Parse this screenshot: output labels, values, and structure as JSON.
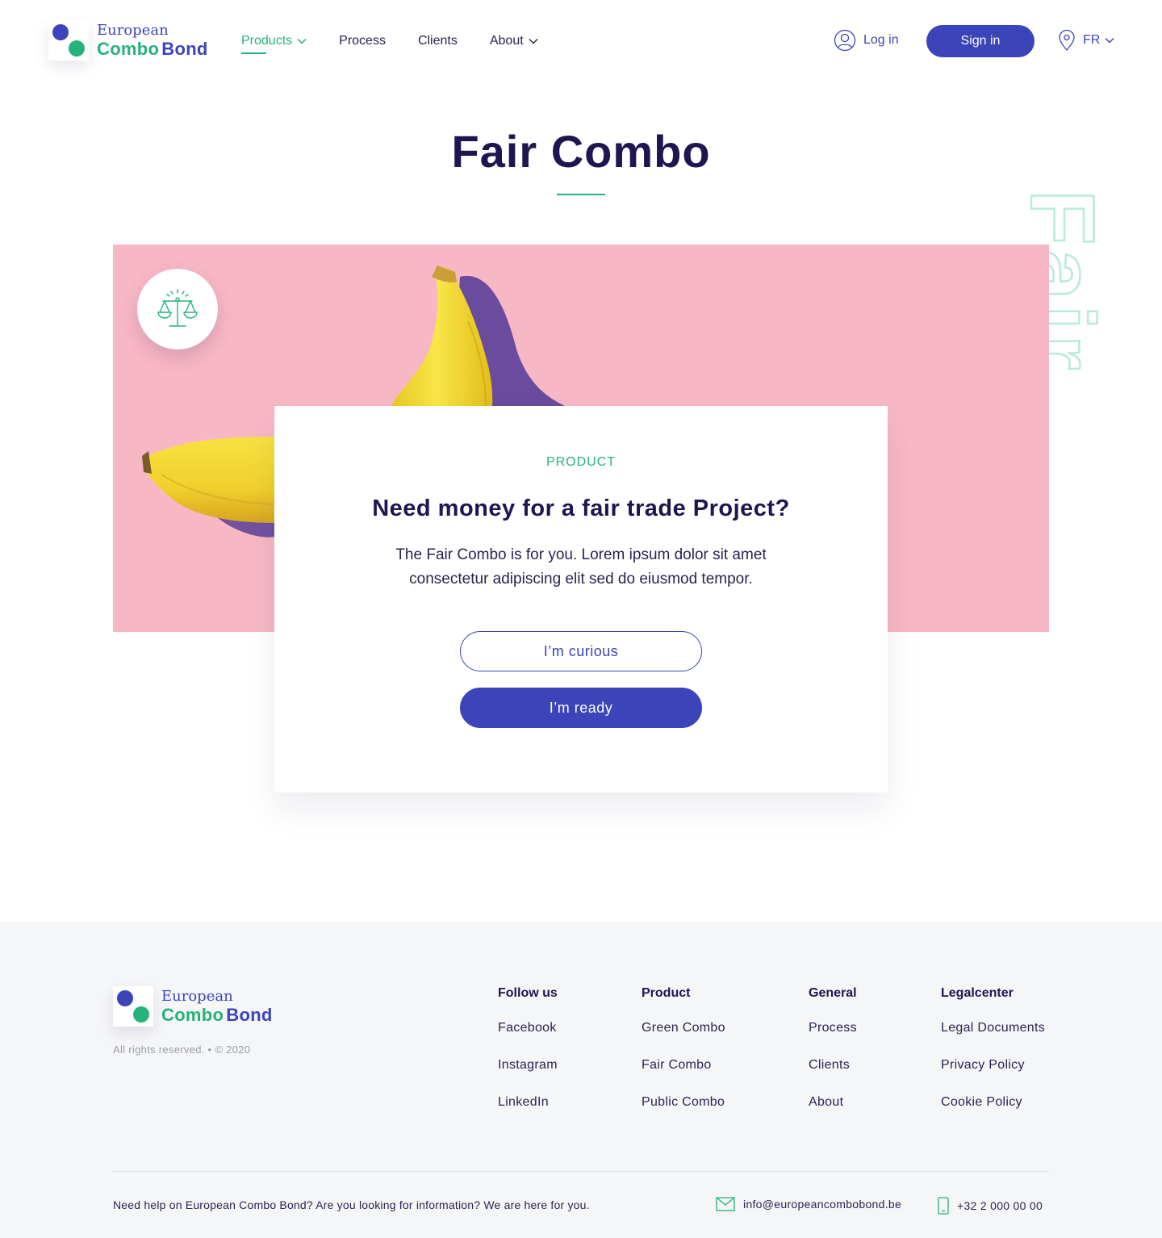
{
  "brand": {
    "line1": "European",
    "line2_a": "Combo",
    "line2_b": "Bond"
  },
  "nav": {
    "items": [
      {
        "label": "Products",
        "has_dropdown": true,
        "active": true
      },
      {
        "label": "Process",
        "has_dropdown": false,
        "active": false
      },
      {
        "label": "Clients",
        "has_dropdown": false,
        "active": false
      },
      {
        "label": "About",
        "has_dropdown": true,
        "active": false
      }
    ],
    "login_label": "Log in",
    "signin_label": "Sign in",
    "language": "FR"
  },
  "hero": {
    "title": "Fair Combo",
    "watermark": "Fair",
    "badge_icon": "balance-scale-icon"
  },
  "card": {
    "kicker": "PRODUCT",
    "headline": "Need money for a fair trade Project?",
    "description": "The Fair Combo is for you. Lorem ipsum dolor sit amet consectetur adipiscing elit sed do eiusmod tempor.",
    "secondary_button": "I’m curious",
    "primary_button": "I’m ready"
  },
  "footer": {
    "rights": "All rights reserved. • © 2020",
    "columns": [
      {
        "title": "Follow us",
        "links": [
          "Facebook",
          "Instagram",
          "LinkedIn"
        ]
      },
      {
        "title": "Product",
        "links": [
          "Green Combo",
          "Fair Combo",
          "Public Combo"
        ]
      },
      {
        "title": "General",
        "links": [
          "Process",
          "Clients",
          "About"
        ]
      },
      {
        "title": "Legalcenter",
        "links": [
          "Legal Documents",
          "Privacy Policy",
          "Cookie Policy"
        ]
      }
    ],
    "help_text": "Need help on European Combo Bond? Are you looking for information? We are here for you.",
    "email": "info@europeancombobond.be",
    "phone": "+32 2 000 00 00"
  },
  "colors": {
    "brand_blue": "#3b44b8",
    "brand_green": "#26b27a",
    "navy_text": "#1f1550",
    "banner_pink": "#f8b7c4",
    "footer_bg": "#f5f6f8"
  }
}
